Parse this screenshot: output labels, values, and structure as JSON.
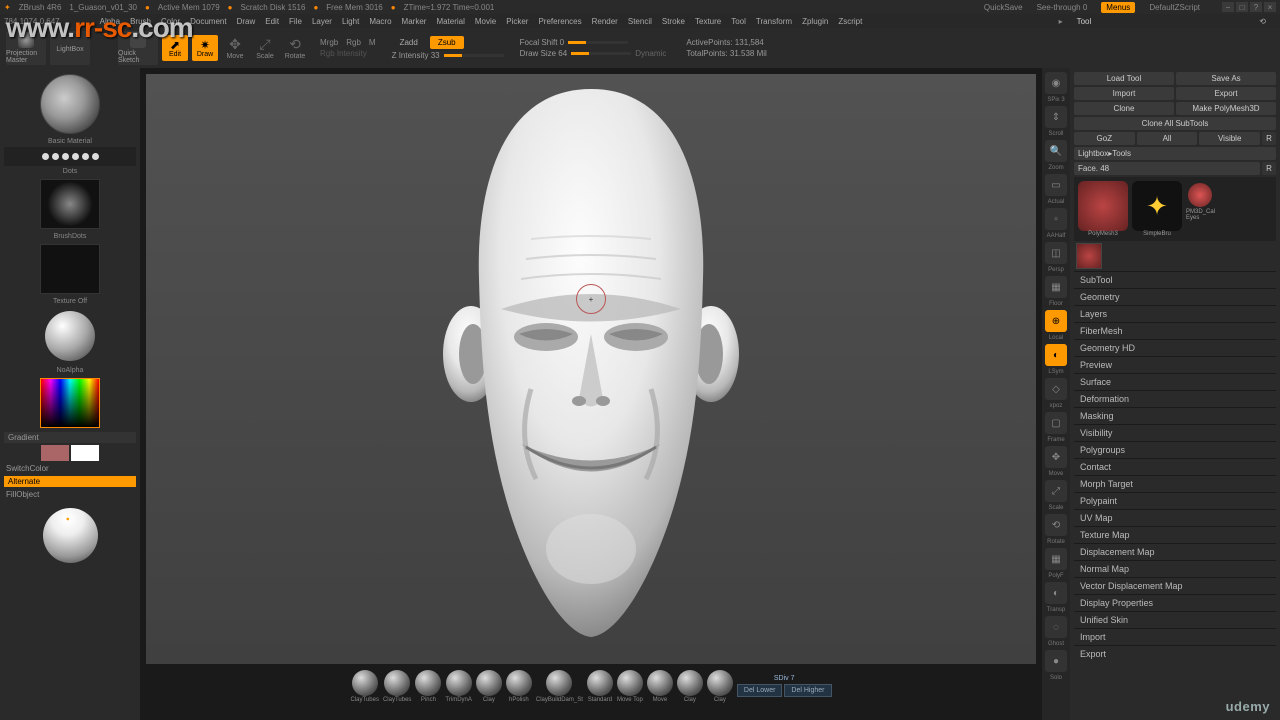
{
  "titlebar": {
    "app": "ZBrush 4R6",
    "file": "1_Guason_v01_30",
    "mem": "Active Mem 1079",
    "scratch": "Scratch Disk 1516",
    "free": "Free Mem 3016",
    "ztime": "ZTime≈1.972 Time≈0.001",
    "quicksave": "QuickSave",
    "seethrough": "See-through  0",
    "menus": "Menus",
    "zscript": "DefaultZScript"
  },
  "menubar": {
    "items": [
      "Alpha",
      "Brush",
      "Color",
      "Document",
      "Draw",
      "Edit",
      "File",
      "Layer",
      "Light",
      "Macro",
      "Marker",
      "Material",
      "Movie",
      "Picker",
      "Preferences",
      "Render",
      "Stencil",
      "Stroke",
      "Texture",
      "Tool",
      "Transform",
      "Zplugin",
      "Zscript"
    ]
  },
  "toolbar": {
    "coords": "784.1074,0.647",
    "projection": "Projection Master",
    "lightbox": "LightBox",
    "quicksketch": "Quick Sketch",
    "edit": "Edit",
    "draw": "Draw",
    "move": "Move",
    "scale": "Scale",
    "rotate": "Rotate",
    "mrgb": "Mrgb",
    "rgb": "Rgb",
    "m": "M",
    "rgbint": "Rgb Intensity",
    "zadd": "Zadd",
    "zsub": "Zsub",
    "zint": "Z Intensity 33",
    "focal": "Focal Shift 0",
    "drawsize": "Draw Size 64",
    "dynamic": "Dynamic",
    "active": "ActivePoints: 131,584",
    "total": "TotalPoints: 31.538 Mil"
  },
  "left": {
    "material": "Basic Material",
    "dots": "Dots",
    "brushdots": "BrushDots",
    "texture": "Texture Off",
    "noalpha": "NoAlpha",
    "gradient": "Gradient",
    "switch": "SwitchColor",
    "alternate": "Alternate",
    "fillobj": "FillObject"
  },
  "brushes": [
    "ClayTubes",
    "ClayTubes",
    "Pinch",
    "TrimDynA",
    "Clay",
    "hPolish",
    "ClayBuildDam_St",
    "Standard",
    "Move Top",
    "Move",
    "Clay",
    "Clay"
  ],
  "del": {
    "lower": "Del Lower",
    "higher": "Del Higher",
    "sdiv": "SDiv 7"
  },
  "side": [
    "SPix 3",
    "Scroll",
    "Zoom",
    "Actual",
    "AAHalf",
    "Persp",
    "Floor",
    "Local",
    "LSym",
    "xpoz",
    "Xpoz",
    "",
    "Frame",
    "Move",
    "Scale",
    "Rotate",
    "PolyF",
    "Transp",
    "Ghost",
    "Solo"
  ],
  "right": {
    "tool": "Tool",
    "load": "Load Tool",
    "saveas": "Save As",
    "import": "Import",
    "export": "Export",
    "clone": "Clone",
    "makepoly": "Make PolyMesh3D",
    "cloneall": "Clone All SubTools",
    "goz": "GoZ",
    "all": "All",
    "visible": "Visible",
    "ltools": "Lightbox▸Tools",
    "face": "Face. 48",
    "polymesh": "PolyMesh3",
    "simple": "SimpleBru",
    "pm3d": "PM3D_Cal",
    "eyes": "Eyes",
    "sections": [
      "SubTool",
      "Geometry",
      "Layers",
      "FiberMesh",
      "Geometry HD",
      "Preview",
      "Surface",
      "Deformation",
      "Masking",
      "Visibility",
      "Polygroups",
      "Contact",
      "Morph Target",
      "Polypaint",
      "UV Map",
      "Texture Map",
      "Displacement Map",
      "Normal Map",
      "Vector Displacement Map",
      "Display Properties",
      "Unified Skin",
      "Import",
      "Export"
    ]
  },
  "watermark": "www.rr-sc.com",
  "udemy": "udemy"
}
